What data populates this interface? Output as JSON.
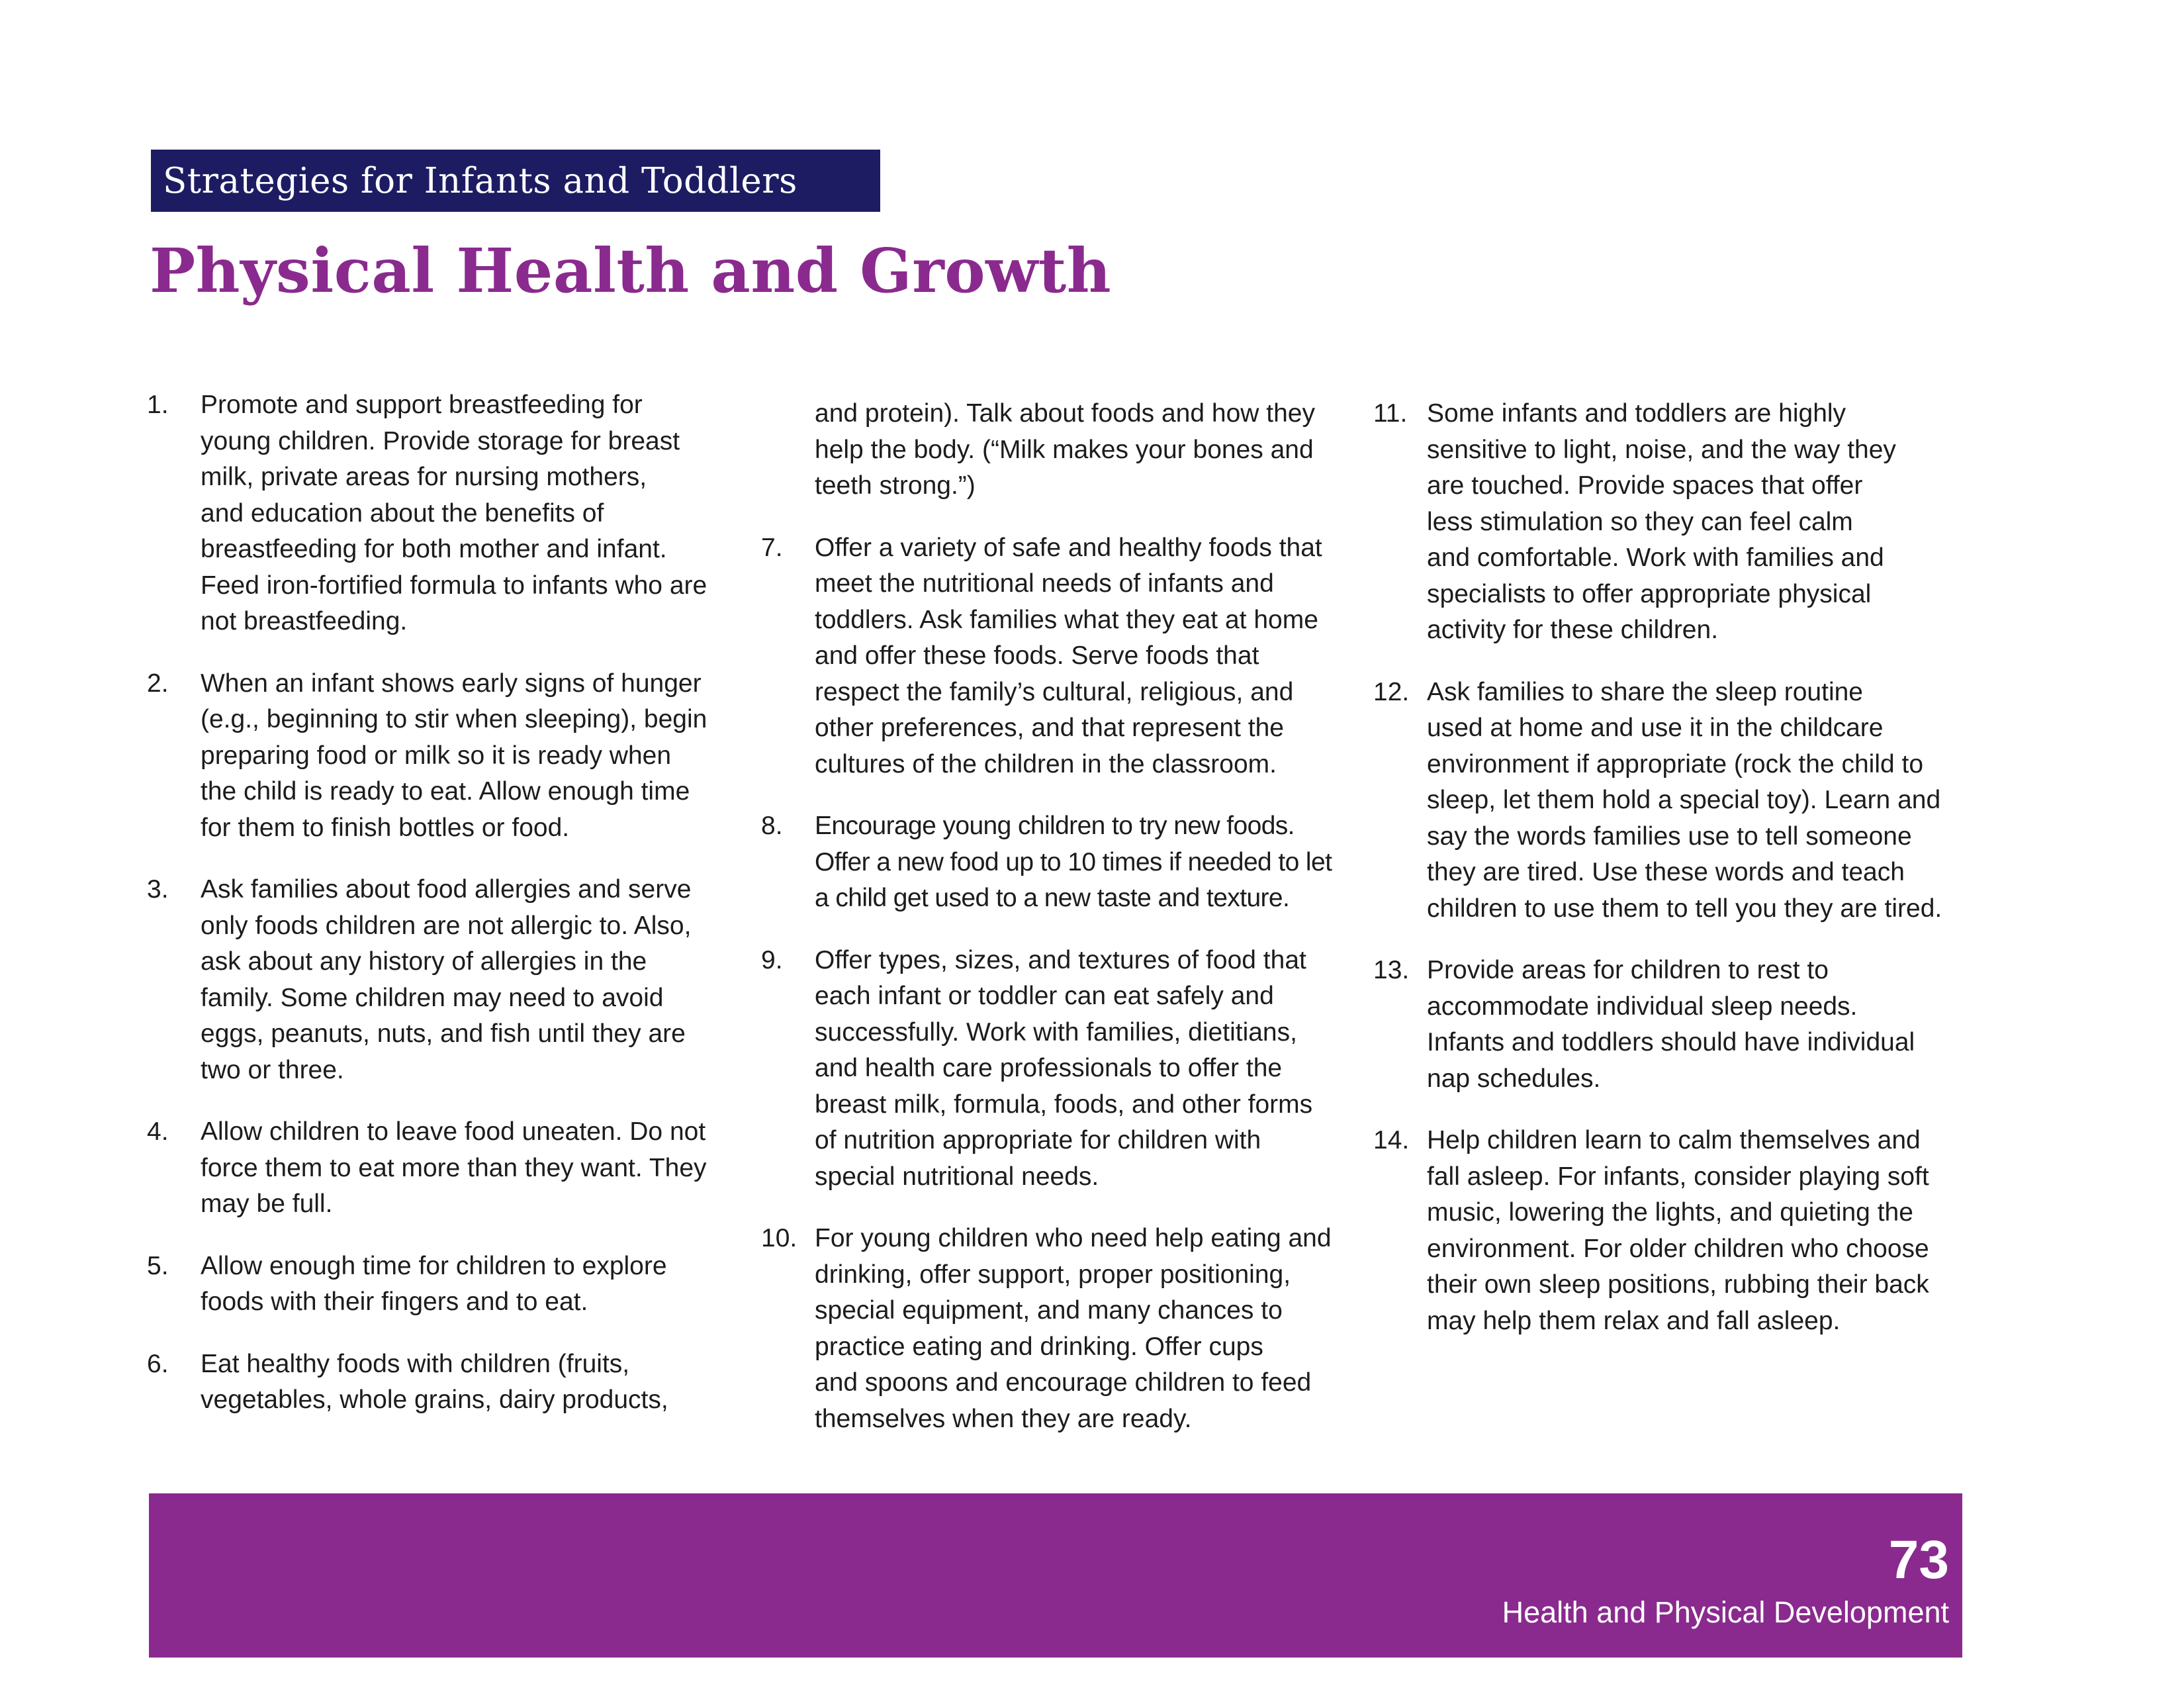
{
  "header": {
    "banner": "Strategies for Infants and Toddlers",
    "title": "Physical Health and Growth"
  },
  "columns": {
    "col1": [
      {
        "num": "1.",
        "text": "Promote and support breastfeeding for\nyoung children. Provide storage for breast\nmilk, private areas for nursing mothers,\nand education about the benefits of\nbreastfeeding for both mother and infant.\nFeed iron-fortified formula to infants who are\nnot breastfeeding."
      },
      {
        "num": "2.",
        "text": "When an infant shows early signs of hunger\n(e.g., beginning to stir when sleeping), begin\npreparing food or milk so it is ready when\nthe child is ready to eat. Allow enough time\nfor them to finish bottles or food."
      },
      {
        "num": "3.",
        "text": "Ask families about food allergies and serve\nonly foods children are not allergic to. Also,\nask about any history of allergies in the\nfamily. Some children may need to avoid\neggs, peanuts, nuts, and fish until they are\ntwo or three."
      },
      {
        "num": "4.",
        "text": "Allow children to leave food uneaten. Do not\nforce them to eat more than they want. They\nmay be full."
      },
      {
        "num": "5.",
        "text": "Allow enough time for children to explore\nfoods with their fingers and to eat."
      },
      {
        "num": "6.",
        "text": "Eat healthy foods with children (fruits,\nvegetables, whole grains, dairy products,"
      }
    ],
    "col2_continuation": "and protein). Talk about foods and how they\nhelp the body. (“Milk makes your bones and\nteeth strong.”)",
    "col2": [
      {
        "num": "7.",
        "text": "Offer a variety of safe and healthy foods that\nmeet the nutritional needs of infants and\ntoddlers. Ask families what they eat at home\nand offer these foods. Serve foods that\nrespect the family’s cultural, religious, and\nother preferences, and that represent the\ncultures of the children in the classroom."
      },
      {
        "num": "8.",
        "text": "Encourage young children to try new foods.\nOffer a new food up to 10 times if needed to let\na child get used to a new taste and texture."
      },
      {
        "num": "9.",
        "text": "Offer types, sizes, and textures of food that\neach infant or toddler can eat safely and\nsuccessfully. Work with families, dietitians,\nand health care professionals to offer the\nbreast milk, formula, foods, and other forms\nof nutrition appropriate for children with\nspecial nutritional needs."
      },
      {
        "num": "10.",
        "text": "For young children who need help eating and\ndrinking, offer support, proper positioning,\nspecial equipment, and many chances to\npractice eating and drinking. Offer cups\nand spoons and encourage children to feed\nthemselves when they are ready."
      }
    ],
    "col3": [
      {
        "num": "11.",
        "text": "Some infants and toddlers are highly\nsensitive to light, noise, and the way they\nare touched. Provide spaces that offer\nless stimulation so they can feel calm\nand comfortable. Work with families and\nspecialists to offer appropriate physical\nactivity for these children."
      },
      {
        "num": "12.",
        "text": "Ask families to share the sleep routine\nused at home and use it in the childcare\nenvironment if appropriate (rock the child to\nsleep, let them hold a special toy). Learn and\nsay the words families use to tell someone\nthey are tired. Use these words and teach\nchildren to use them to tell you they are tired."
      },
      {
        "num": "13.",
        "text": "Provide areas for children to rest to\naccommodate individual sleep needs.\nInfants and toddlers should have individual\nnap schedules."
      },
      {
        "num": "14.",
        "text": "Help children learn to calm themselves and\nfall asleep. For infants, consider playing soft\nmusic, lowering the lights, and quieting the\nenvironment. For older children who choose\ntheir own sleep positions, rubbing their back\nmay help them relax and fall asleep."
      }
    ]
  },
  "footer": {
    "page_number": "73",
    "section": "Health and Physical Development"
  },
  "colors": {
    "banner_bg": "#1d1c63",
    "accent_purple": "#8a2a8e",
    "text": "#1c1c1c"
  }
}
